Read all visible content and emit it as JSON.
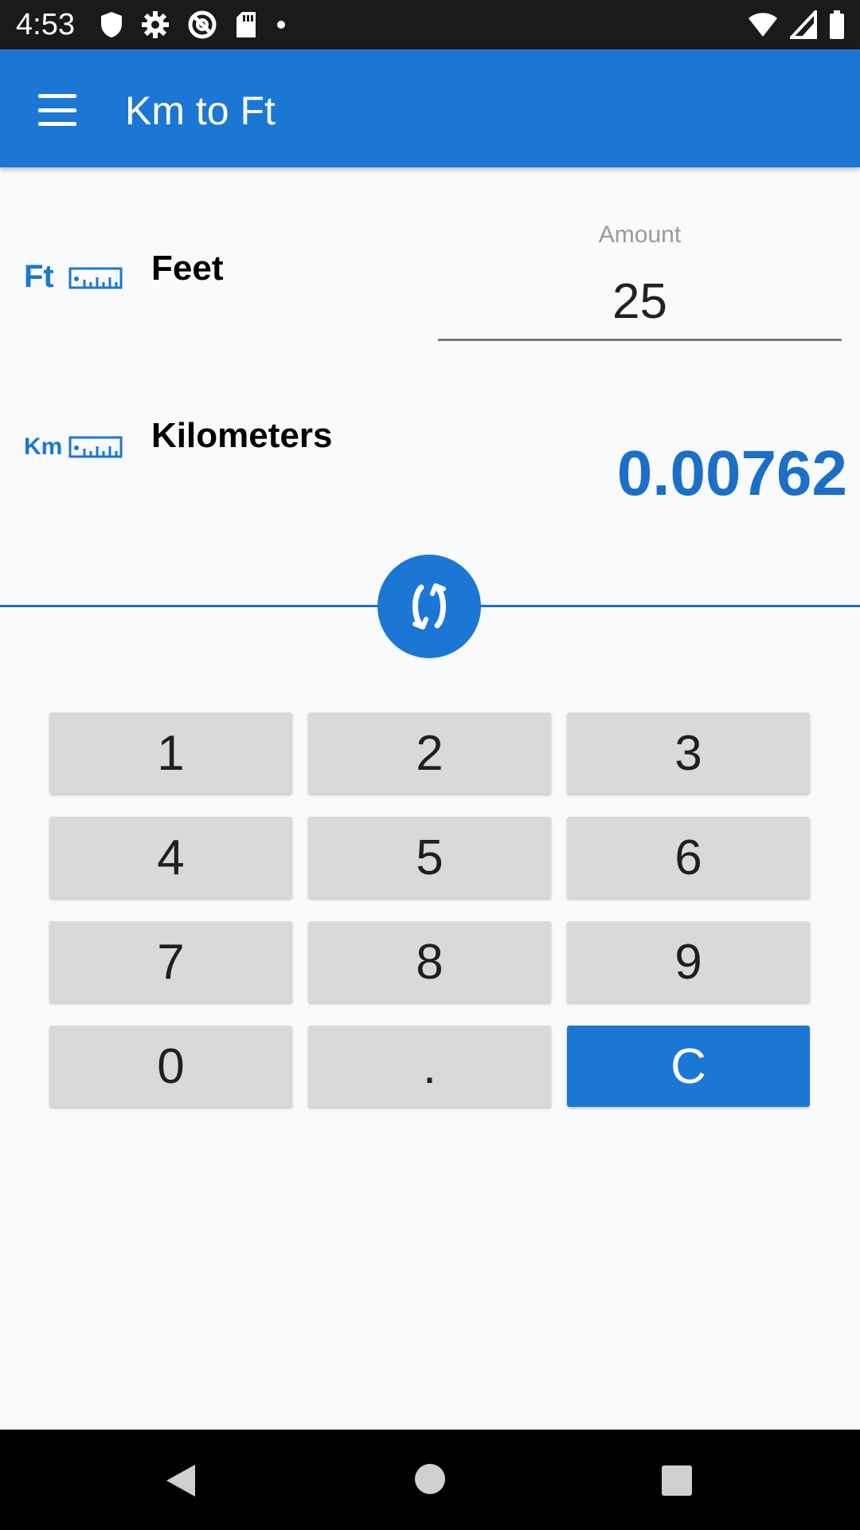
{
  "status_bar": {
    "time": "4:53",
    "icons_left": [
      "shield-icon",
      "gear-icon",
      "no-sync-icon",
      "sd-card-icon",
      "dot-icon"
    ],
    "icons_right": [
      "wifi-icon",
      "signal-icon",
      "battery-icon"
    ]
  },
  "app_bar": {
    "title": "Km to Ft",
    "color": "#1b77d3"
  },
  "from_unit": {
    "icon": "Ft",
    "name": "Feet"
  },
  "amount": {
    "label": "Amount",
    "value": "25"
  },
  "to_unit": {
    "icon": "Km",
    "name": "Kilometers",
    "result": "0.00762"
  },
  "keypad": {
    "keys": [
      "1",
      "2",
      "3",
      "4",
      "5",
      "6",
      "7",
      "8",
      "9",
      "0",
      ".",
      "C"
    ]
  },
  "colors": {
    "accent": "#1b77d3",
    "result": "#1b6fc7",
    "key_bg": "#d9d9dc"
  }
}
